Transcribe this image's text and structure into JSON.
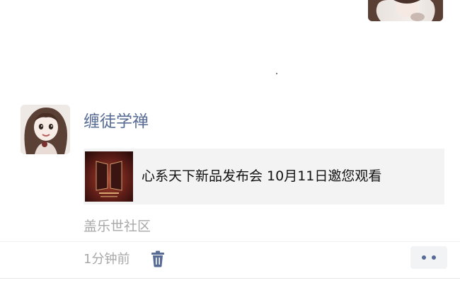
{
  "prev_post": {
    "image_icon": "avatar-thumbnail-icon"
  },
  "post": {
    "avatar_icon": "user-avatar-icon",
    "username": "缠徒学禅",
    "shared_link": {
      "thumbnail_icon": "event-poster-icon",
      "title": "心系天下新品发布会 10月11日邀您观看"
    },
    "source": "盖乐世社区",
    "time": "1分钟前",
    "delete_icon": "trash-icon",
    "more_icon": "more-dots-icon"
  },
  "colors": {
    "link_blue": "#576b95",
    "meta_gray": "#a8a8a8",
    "card_bg": "#f3f3f3"
  }
}
